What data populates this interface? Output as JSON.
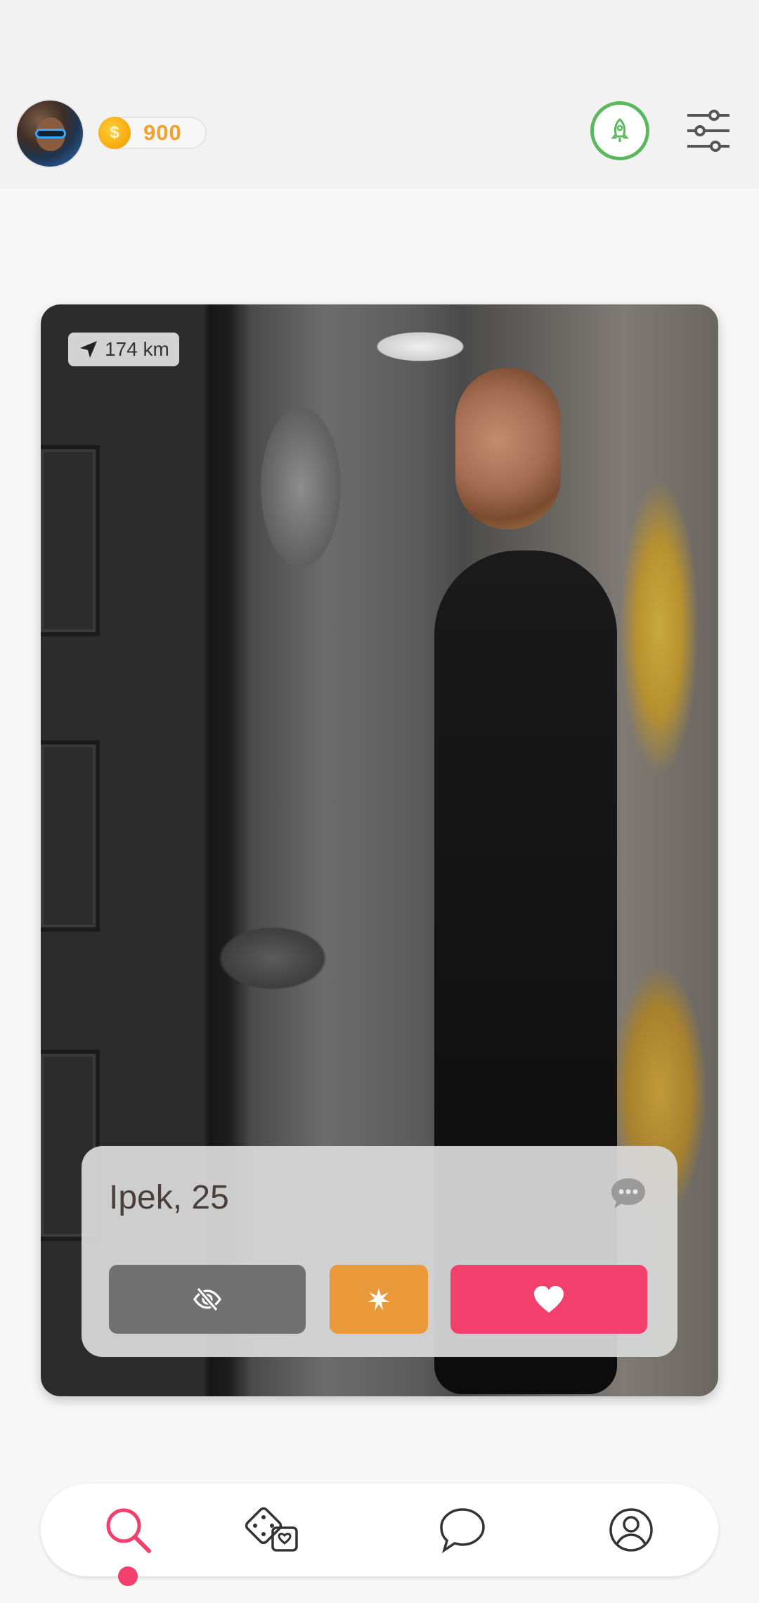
{
  "header": {
    "coins": "900",
    "coin_symbol": "$"
  },
  "card": {
    "distance": "174 km",
    "name_age": "Ipek, 25"
  },
  "colors": {
    "accent": "#f23f6b",
    "boost": "#5cb85c",
    "coin_text": "#f2a12d",
    "superlike": "#e9983a",
    "hide": "#707070"
  },
  "bottom_nav": {
    "items": [
      {
        "icon": "search-icon",
        "active": true
      },
      {
        "icon": "dice-icon",
        "active": false
      },
      {
        "icon": "chat-icon",
        "active": false
      },
      {
        "icon": "profile-icon",
        "active": false
      }
    ]
  }
}
